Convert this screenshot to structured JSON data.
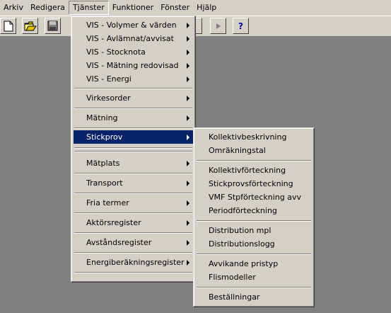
{
  "menubar": [
    "Arkiv",
    "Redigera",
    "Tjänster",
    "Funktioner",
    "Fönster",
    "Hjälp"
  ],
  "toolbar": {
    "buttons": [
      "new-document-icon",
      "open-folder-icon",
      "save-disk-icon"
    ],
    "help_label": "?"
  },
  "tjanster_menu": {
    "items": [
      {
        "label": "VIS - Volymer & värden",
        "submenu": true
      },
      {
        "label": "VIS - Avlämnat/avvisat",
        "submenu": true
      },
      {
        "label": "VIS - Stocknota",
        "submenu": true
      },
      {
        "label": "VIS - Mätning redovisad",
        "submenu": true
      },
      {
        "label": "VIS - Energi",
        "submenu": true
      },
      {
        "label": "Virkesorder",
        "submenu": true
      },
      {
        "label": "Mätning",
        "submenu": true
      },
      {
        "label": "Stickprov",
        "submenu": true,
        "active": true
      },
      {
        "label": "Mätplats",
        "submenu": true
      },
      {
        "label": "Transport",
        "submenu": true
      },
      {
        "label": "Fria termer",
        "submenu": true
      },
      {
        "label": "Aktörsregister",
        "submenu": true
      },
      {
        "label": "Avståndsregister",
        "submenu": true
      },
      {
        "label": "Energiberäkningsregister",
        "submenu": true
      }
    ]
  },
  "stickprov_submenu": {
    "items": [
      "Kollektivbeskrivning",
      "Omräkningstal",
      "Kollektivförteckning",
      "Stickprovsförteckning",
      "VMF Stpförteckning avv",
      "Periodförteckning",
      "Distribution mpl",
      "Distributionslogg",
      "Avvikande pristyp",
      "Flismodeller",
      "Beställningar"
    ]
  }
}
